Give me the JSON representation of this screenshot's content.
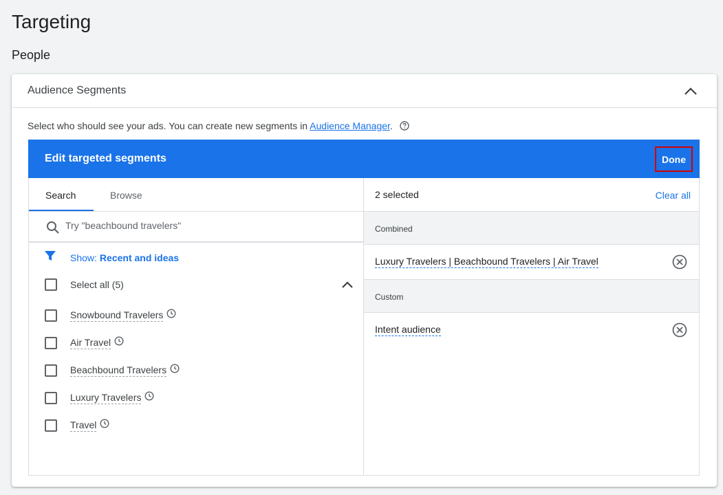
{
  "page": {
    "title": "Targeting",
    "section": "People"
  },
  "card": {
    "title": "Audience Segments",
    "description_prefix": "Select who should see your ads.  You can create new segments in ",
    "description_link": "Audience Manager",
    "description_suffix": "."
  },
  "panel": {
    "title": "Edit targeted segments",
    "done_label": "Done",
    "header_color": "#1a73e8"
  },
  "tabs": [
    {
      "label": "Search",
      "active": true
    },
    {
      "label": "Browse",
      "active": false
    }
  ],
  "search": {
    "placeholder": "Try \"beachbound travelers\""
  },
  "filter": {
    "label": "Show:",
    "value": "Recent and ideas"
  },
  "select_all": {
    "label": "Select all (5)"
  },
  "segments": [
    {
      "label": "Snowbound Travelers",
      "icon": "clock-icon"
    },
    {
      "label": "Air Travel",
      "icon": "clock-icon"
    },
    {
      "label": "Beachbound Travelers",
      "icon": "clock-icon"
    },
    {
      "label": "Luxury Travelers",
      "icon": "clock-icon"
    },
    {
      "label": "Travel",
      "icon": "clock-icon"
    }
  ],
  "selected": {
    "count_label": "2 selected",
    "clear_label": "Clear all",
    "groups": [
      {
        "name": "Combined",
        "items": [
          "Luxury Travelers | Beachbound Travelers | Air Travel"
        ]
      },
      {
        "name": "Custom",
        "items": [
          "Intent audience"
        ]
      }
    ]
  }
}
